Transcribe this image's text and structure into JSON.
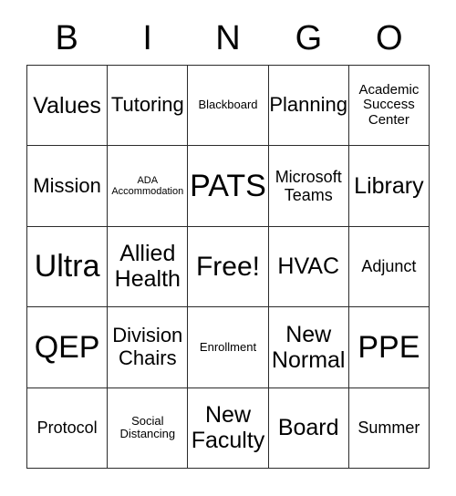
{
  "header": {
    "letters": [
      "B",
      "I",
      "N",
      "G",
      "O"
    ]
  },
  "grid": {
    "columns": 5,
    "rows": 5,
    "cells": [
      {
        "text": "Values",
        "size": "lg"
      },
      {
        "text": "Tutoring",
        "size": "md"
      },
      {
        "text": "Blackboard",
        "size": "xxs"
      },
      {
        "text": "Planning",
        "size": "md"
      },
      {
        "text": "Academic Success Center",
        "size": "xs"
      },
      {
        "text": "Mission",
        "size": "md"
      },
      {
        "text": "ADA Accommodation",
        "size": "tiny"
      },
      {
        "text": "PATS",
        "size": "xxl"
      },
      {
        "text": "Microsoft Teams",
        "size": "sm"
      },
      {
        "text": "Library",
        "size": "lg"
      },
      {
        "text": "Ultra",
        "size": "xxl"
      },
      {
        "text": "Allied Health",
        "size": "lg"
      },
      {
        "text": "Free!",
        "size": "xl"
      },
      {
        "text": "HVAC",
        "size": "lg"
      },
      {
        "text": "Adjunct",
        "size": "sm"
      },
      {
        "text": "QEP",
        "size": "xxl"
      },
      {
        "text": "Division Chairs",
        "size": "md"
      },
      {
        "text": "Enrollment",
        "size": "xxs"
      },
      {
        "text": "New Normal",
        "size": "lg"
      },
      {
        "text": "PPE",
        "size": "xxl"
      },
      {
        "text": "Protocol",
        "size": "sm"
      },
      {
        "text": "Social Distancing",
        "size": "xxs"
      },
      {
        "text": "New Faculty",
        "size": "lg"
      },
      {
        "text": "Board",
        "size": "lg"
      },
      {
        "text": "Summer",
        "size": "sm"
      }
    ]
  },
  "colors": {
    "border": "#2b2b2b",
    "background": "#ffffff",
    "text": "#000000"
  }
}
